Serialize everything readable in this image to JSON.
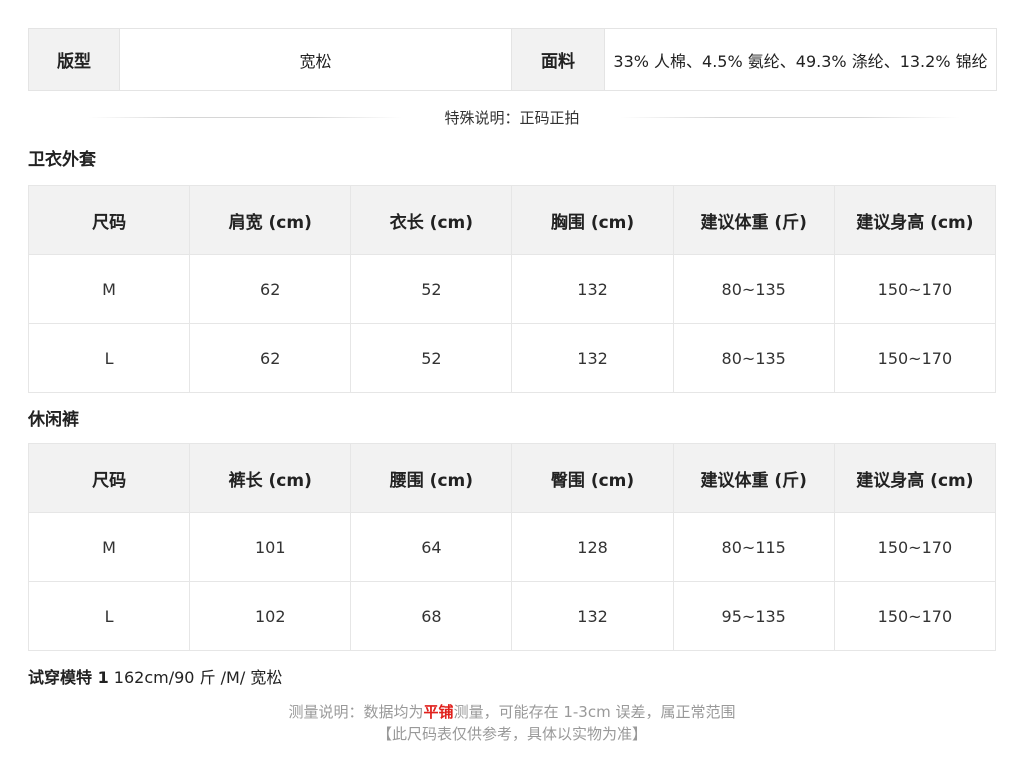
{
  "attributes": {
    "fit_label": "版型",
    "fit_value": "宽松",
    "fabric_label": "面料",
    "fabric_value": "33% 人棉、4.5% 氨纶、49.3% 涤纶、13.2% 锦纶"
  },
  "special_note": "特殊说明：正码正拍",
  "hoodie": {
    "title": "卫衣外套",
    "headers": [
      "尺码",
      "肩宽 (cm)",
      "衣长 (cm)",
      "胸围 (cm)",
      "建议体重 (斤)",
      "建议身高 (cm)"
    ],
    "rows": [
      [
        "M",
        "62",
        "52",
        "132",
        "80~135",
        "150~170"
      ],
      [
        "L",
        "62",
        "52",
        "132",
        "80~135",
        "150~170"
      ]
    ]
  },
  "pants": {
    "title": "休闲裤",
    "headers": [
      "尺码",
      "裤长 (cm)",
      "腰围 (cm)",
      "臀围 (cm)",
      "建议体重 (斤)",
      "建议身高 (cm)"
    ],
    "rows": [
      [
        "M",
        "101",
        "64",
        "128",
        "80~115",
        "150~170"
      ],
      [
        "L",
        "102",
        "68",
        "132",
        "95~135",
        "150~170"
      ]
    ]
  },
  "model": {
    "label": "试穿模特 1",
    "value": " 162cm/90 斤 /M/ 宽松"
  },
  "footer": {
    "line1_prefix": "测量说明：数据均为",
    "line1_highlight": "平铺",
    "line1_suffix": "测量，可能存在 1-3cm 误差，属正常范围",
    "line2": "【此尺码表仅供参考，具体以实物为准】",
    "highlight_color": "#e0201c"
  }
}
